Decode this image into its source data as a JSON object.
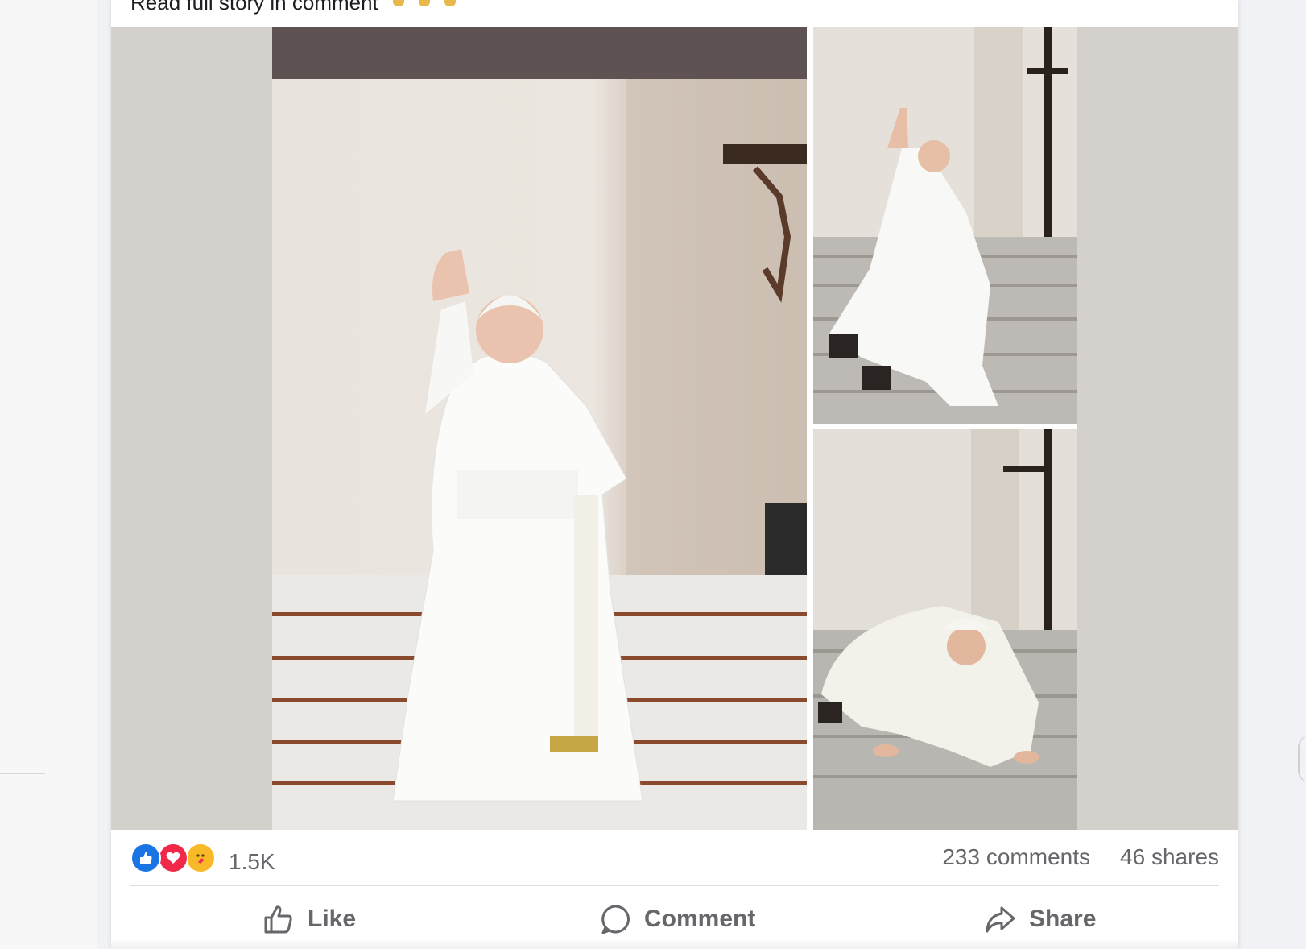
{
  "post": {
    "caption": "Read full story in comment",
    "reactions": {
      "types": [
        "like-icon",
        "love-icon",
        "care-icon"
      ],
      "count": "1.5K"
    },
    "comments_count": "233 comments",
    "shares_count": "46 shares"
  },
  "actions": {
    "like_label": "Like",
    "comment_label": "Comment",
    "share_label": "Share"
  },
  "colors": {
    "like_blue": "#1b74e4",
    "love_red": "#f0284a",
    "care_yellow": "#f7b928",
    "muted_text": "#65676b"
  }
}
